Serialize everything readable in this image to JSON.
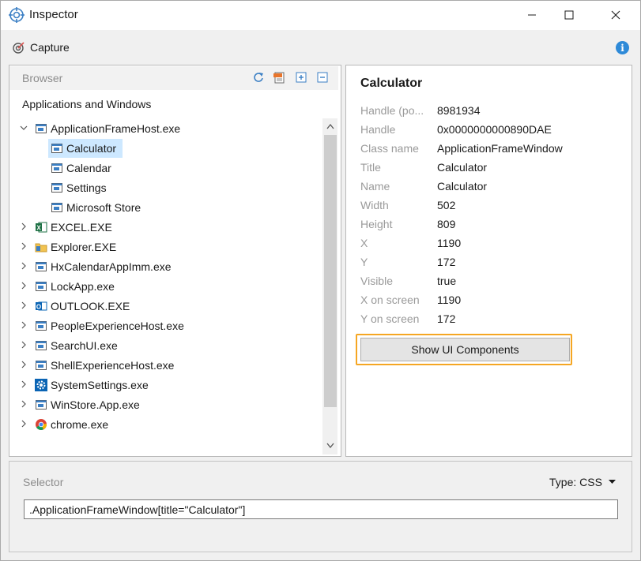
{
  "window": {
    "title": "Inspector"
  },
  "toolbar": {
    "capture_label": "Capture",
    "info_glyph": "i"
  },
  "browser": {
    "header": "Browser",
    "toolbar_icons": [
      "refresh-icon",
      "xml-export-icon",
      "expand-all-icon",
      "collapse-all-icon"
    ],
    "section_label": "Applications and Windows",
    "tree": [
      {
        "label": "ApplicationFrameHost.exe",
        "icon": "window-icon",
        "expanded": true,
        "children": [
          {
            "label": "Calculator",
            "icon": "window-icon",
            "selected": true
          },
          {
            "label": "Calendar",
            "icon": "window-icon"
          },
          {
            "label": "Settings",
            "icon": "window-icon"
          },
          {
            "label": "Microsoft Store",
            "icon": "window-icon"
          }
        ]
      },
      {
        "label": "EXCEL.EXE",
        "icon": "excel-icon"
      },
      {
        "label": "Explorer.EXE",
        "icon": "folder-icon"
      },
      {
        "label": "HxCalendarAppImm.exe",
        "icon": "window-icon"
      },
      {
        "label": "LockApp.exe",
        "icon": "window-icon"
      },
      {
        "label": "OUTLOOK.EXE",
        "icon": "outlook-icon"
      },
      {
        "label": "PeopleExperienceHost.exe",
        "icon": "window-icon"
      },
      {
        "label": "SearchUI.exe",
        "icon": "window-icon"
      },
      {
        "label": "ShellExperienceHost.exe",
        "icon": "window-icon"
      },
      {
        "label": "SystemSettings.exe",
        "icon": "gear-icon"
      },
      {
        "label": "WinStore.App.exe",
        "icon": "window-icon"
      },
      {
        "label": "chrome.exe",
        "icon": "chrome-icon"
      }
    ]
  },
  "details": {
    "title": "Calculator",
    "properties": [
      {
        "name": "Handle (po...",
        "value": "8981934"
      },
      {
        "name": "Handle",
        "value": "0x0000000000890DAE"
      },
      {
        "name": "Class name",
        "value": "ApplicationFrameWindow"
      },
      {
        "name": "Title",
        "value": "Calculator"
      },
      {
        "name": "Name",
        "value": "Calculator"
      },
      {
        "name": "Width",
        "value": "502"
      },
      {
        "name": "Height",
        "value": "809"
      },
      {
        "name": "X",
        "value": "1190"
      },
      {
        "name": "Y",
        "value": "172"
      },
      {
        "name": "Visible",
        "value": "true"
      },
      {
        "name": "X on screen",
        "value": "1190"
      },
      {
        "name": "Y on screen",
        "value": "172"
      }
    ],
    "show_button_label": "Show UI Components"
  },
  "selector": {
    "label": "Selector",
    "type_label": "Type: CSS",
    "value": ".ApplicationFrameWindow[title=\"Calculator\"]"
  },
  "colors": {
    "accent_outline": "#f5a623",
    "selection": "#cde8ff",
    "info": "#2e8ad8"
  }
}
